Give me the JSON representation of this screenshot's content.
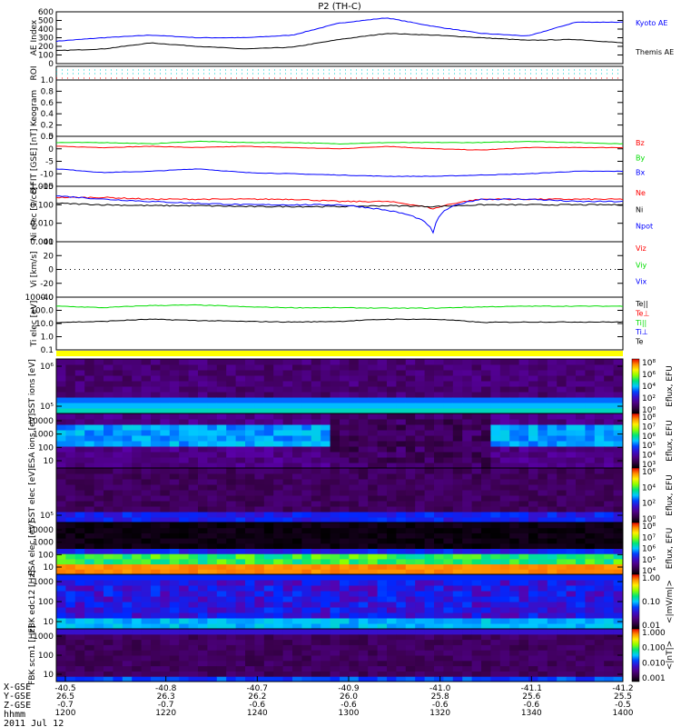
{
  "title": "P2 (TH-C)",
  "chart_data": [
    {
      "type": "line",
      "id": "ae",
      "ylabel": "AE Index",
      "ylim": [
        0,
        600
      ],
      "yticks": [
        "0",
        "100",
        "200",
        "300",
        "400",
        "500",
        "600"
      ],
      "scale": "linear",
      "x": [
        "1200",
        "1210",
        "1220",
        "1230",
        "1240",
        "1250",
        "1300",
        "1310",
        "1320",
        "1330",
        "1340",
        "1350",
        "1400"
      ],
      "series": [
        {
          "name": "Kyoto AE",
          "color": "#0000ff",
          "values": [
            260,
            300,
            330,
            300,
            300,
            330,
            470,
            530,
            430,
            350,
            320,
            480,
            480
          ]
        },
        {
          "name": "Themis AE",
          "color": "#000000",
          "values": [
            150,
            170,
            240,
            200,
            170,
            190,
            280,
            350,
            330,
            300,
            270,
            280,
            240
          ]
        }
      ]
    },
    {
      "type": "line",
      "id": "roi",
      "ylabel": "ROI",
      "series": []
    },
    {
      "type": "line",
      "id": "keo",
      "ylabel": "Keogram",
      "ylim": [
        0,
        1
      ],
      "yticks": [
        "0.0",
        "0.2",
        "0.4",
        "0.6",
        "0.8",
        "1.0"
      ],
      "scale": "linear",
      "series": []
    },
    {
      "type": "line",
      "id": "b",
      "ylabel": "B FIT [GSE] [nT]",
      "ylim": [
        -15,
        5
      ],
      "yticks": [
        "-15",
        "-10",
        "-5",
        "0",
        "5"
      ],
      "scale": "linear",
      "series": [
        {
          "name": "Bz",
          "color": "#ff0000",
          "values": [
            1,
            0.5,
            1,
            0.5,
            1,
            0.5,
            0,
            1,
            0,
            -0.5,
            0.5,
            0.5,
            0.5
          ]
        },
        {
          "name": "By",
          "color": "#00dd00",
          "values": [
            2.5,
            2.5,
            2,
            3,
            2.5,
            2.5,
            2,
            2.5,
            2.5,
            2.5,
            3,
            2.5,
            2
          ]
        },
        {
          "name": "Bx",
          "color": "#0000ff",
          "values": [
            -8,
            -9.5,
            -9,
            -8,
            -9.5,
            -10,
            -10.5,
            -11,
            -11,
            -10.5,
            -10,
            -9,
            -9
          ]
        }
      ]
    },
    {
      "type": "line",
      "id": "n",
      "ylabel": "Ni elec [1/cc]",
      "ylim": [
        0.001,
        1
      ],
      "yticks": [
        "0.001",
        "0.010",
        "0.100",
        "1.000"
      ],
      "scale": "log",
      "series": [
        {
          "name": "Ne",
          "color": "#ff0000",
          "values": [
            0.25,
            0.25,
            0.2,
            0.2,
            0.2,
            0.2,
            0.15,
            0.15,
            0.06,
            0.2,
            0.2,
            0.2,
            0.2
          ]
        },
        {
          "name": "Ni",
          "color": "#000000",
          "values": [
            0.12,
            0.1,
            0.09,
            0.09,
            0.08,
            0.08,
            0.08,
            0.09,
            0.08,
            0.1,
            0.1,
            0.1,
            0.1
          ]
        },
        {
          "name": "Npot",
          "color": "#0000ff",
          "values": [
            0.3,
            0.2,
            0.15,
            0.12,
            0.1,
            0.1,
            0.1,
            0.05,
            0.002,
            0.2,
            0.2,
            0.15,
            0.15
          ]
        }
      ]
    },
    {
      "type": "line",
      "id": "v",
      "ylabel": "Vi [km/s]",
      "ylim": [
        -50,
        50
      ],
      "yticks": [
        "-40",
        "-20",
        "0",
        "20",
        "40"
      ],
      "scale": "linear",
      "series": [
        {
          "name": "Viz",
          "color": "#ff0000",
          "values": []
        },
        {
          "name": "Viy",
          "color": "#00dd00",
          "values": []
        },
        {
          "name": "Vix",
          "color": "#0000ff",
          "values": []
        }
      ]
    },
    {
      "type": "line",
      "id": "temp",
      "ylabel": "Ti elec [eV]",
      "ylim": [
        0.05,
        5000
      ],
      "yticks": [
        "0.1",
        "1.0",
        "10.0",
        "100.0",
        "1000.0"
      ],
      "scale": "log",
      "series": [
        {
          "name": "Te||",
          "color": "#000000",
          "values": []
        },
        {
          "name": "Te⊥",
          "color": "#ff0000",
          "values": []
        },
        {
          "name": "Ti||",
          "color": "#00dd00",
          "values": [
            700,
            500,
            800,
            900,
            600,
            500,
            500,
            450,
            450,
            600,
            700,
            700,
            700
          ]
        },
        {
          "name": "Ti⊥",
          "color": "#0000ff",
          "values": []
        },
        {
          "name": "Te",
          "color": "#000000",
          "values": [
            20,
            25,
            40,
            30,
            25,
            22,
            25,
            40,
            40,
            20,
            22,
            22,
            22
          ]
        }
      ]
    },
    {
      "type": "heatmap",
      "id": "sst_i",
      "ylabel": "SST ions [eV]",
      "yticks": [
        "10⁵",
        "10⁶"
      ],
      "colorbar": {
        "label": "Eflux, EFU",
        "ticks": [
          "10⁰",
          "10²",
          "10⁴",
          "10⁶",
          "10⁸"
        ]
      }
    },
    {
      "type": "heatmap",
      "id": "esa_i",
      "ylabel": "ESA ions [eV]",
      "yticks": [
        "10",
        "100",
        "1000",
        "10000"
      ],
      "colorbar": {
        "label": "Eflux, EFU",
        "ticks": [
          "10³",
          "10⁴",
          "10⁵",
          "10⁶",
          "10⁷",
          "10⁸"
        ]
      }
    },
    {
      "type": "heatmap",
      "id": "sst_e",
      "ylabel": "SST elec [eV]",
      "yticks": [
        "10⁵"
      ],
      "colorbar": {
        "label": "Eflux, EFU",
        "ticks": [
          "10⁰",
          "10²",
          "10⁴",
          "10⁶"
        ]
      }
    },
    {
      "type": "heatmap",
      "id": "esa_e",
      "ylabel": "ESA elec [eV]",
      "yticks": [
        "10",
        "100",
        "1000",
        "10000"
      ],
      "colorbar": {
        "label": "Eflux, EFU",
        "ticks": [
          "10⁴",
          "10⁵",
          "10⁶",
          "10⁷",
          "10⁸"
        ]
      }
    },
    {
      "type": "heatmap",
      "id": "fbk_e",
      "ylabel": "FBK edc12 [Hz]",
      "yticks": [
        "10",
        "100",
        "1000"
      ],
      "colorbar": {
        "label": "<|mV/m|>",
        "ticks": [
          "0.01",
          "0.10",
          "1.00"
        ]
      }
    },
    {
      "type": "heatmap",
      "id": "fbk_b",
      "ylabel": "FBK scm1 [Hz]",
      "yticks": [
        "10",
        "100",
        "1000"
      ],
      "colorbar": {
        "label": "<|nT|>",
        "ticks": [
          "0.001",
          "0.010",
          "0.100",
          "1.000"
        ]
      }
    }
  ],
  "xaxis": {
    "row_labels": [
      "X-GSE",
      "Y-GSE",
      "Z-GSE",
      "hhmm"
    ],
    "date": "2011 Jul 12",
    "ticks": [
      {
        "x": "-40.5",
        "y": "26.5",
        "z": "-0.7",
        "t": "1200"
      },
      {
        "x": "-40.8",
        "y": "26.3",
        "z": "-0.7",
        "t": "1220"
      },
      {
        "x": "-40.7",
        "y": "26.2",
        "z": "-0.6",
        "t": "1240"
      },
      {
        "x": "-40.9",
        "y": "26.0",
        "z": "-0.6",
        "t": "1300"
      },
      {
        "x": "-41.0",
        "y": "25.8",
        "z": "-0.6",
        "t": "1320"
      },
      {
        "x": "-41.1",
        "y": "25.6",
        "z": "-0.6",
        "t": "1340"
      },
      {
        "x": "-41.2",
        "y": "25.5",
        "z": "-0.5",
        "t": "1400"
      }
    ]
  }
}
